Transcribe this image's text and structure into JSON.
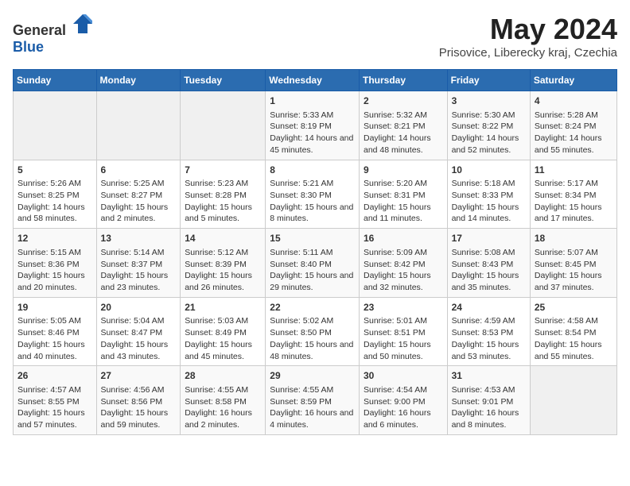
{
  "header": {
    "logo_general": "General",
    "logo_blue": "Blue",
    "title": "May 2024",
    "subtitle": "Prisovice, Liberecky kraj, Czechia"
  },
  "weekdays": [
    "Sunday",
    "Monday",
    "Tuesday",
    "Wednesday",
    "Thursday",
    "Friday",
    "Saturday"
  ],
  "weeks": [
    [
      {
        "day": "",
        "info": ""
      },
      {
        "day": "",
        "info": ""
      },
      {
        "day": "",
        "info": ""
      },
      {
        "day": "1",
        "info": "Sunrise: 5:33 AM\nSunset: 8:19 PM\nDaylight: 14 hours and 45 minutes."
      },
      {
        "day": "2",
        "info": "Sunrise: 5:32 AM\nSunset: 8:21 PM\nDaylight: 14 hours and 48 minutes."
      },
      {
        "day": "3",
        "info": "Sunrise: 5:30 AM\nSunset: 8:22 PM\nDaylight: 14 hours and 52 minutes."
      },
      {
        "day": "4",
        "info": "Sunrise: 5:28 AM\nSunset: 8:24 PM\nDaylight: 14 hours and 55 minutes."
      }
    ],
    [
      {
        "day": "5",
        "info": "Sunrise: 5:26 AM\nSunset: 8:25 PM\nDaylight: 14 hours and 58 minutes."
      },
      {
        "day": "6",
        "info": "Sunrise: 5:25 AM\nSunset: 8:27 PM\nDaylight: 15 hours and 2 minutes."
      },
      {
        "day": "7",
        "info": "Sunrise: 5:23 AM\nSunset: 8:28 PM\nDaylight: 15 hours and 5 minutes."
      },
      {
        "day": "8",
        "info": "Sunrise: 5:21 AM\nSunset: 8:30 PM\nDaylight: 15 hours and 8 minutes."
      },
      {
        "day": "9",
        "info": "Sunrise: 5:20 AM\nSunset: 8:31 PM\nDaylight: 15 hours and 11 minutes."
      },
      {
        "day": "10",
        "info": "Sunrise: 5:18 AM\nSunset: 8:33 PM\nDaylight: 15 hours and 14 minutes."
      },
      {
        "day": "11",
        "info": "Sunrise: 5:17 AM\nSunset: 8:34 PM\nDaylight: 15 hours and 17 minutes."
      }
    ],
    [
      {
        "day": "12",
        "info": "Sunrise: 5:15 AM\nSunset: 8:36 PM\nDaylight: 15 hours and 20 minutes."
      },
      {
        "day": "13",
        "info": "Sunrise: 5:14 AM\nSunset: 8:37 PM\nDaylight: 15 hours and 23 minutes."
      },
      {
        "day": "14",
        "info": "Sunrise: 5:12 AM\nSunset: 8:39 PM\nDaylight: 15 hours and 26 minutes."
      },
      {
        "day": "15",
        "info": "Sunrise: 5:11 AM\nSunset: 8:40 PM\nDaylight: 15 hours and 29 minutes."
      },
      {
        "day": "16",
        "info": "Sunrise: 5:09 AM\nSunset: 8:42 PM\nDaylight: 15 hours and 32 minutes."
      },
      {
        "day": "17",
        "info": "Sunrise: 5:08 AM\nSunset: 8:43 PM\nDaylight: 15 hours and 35 minutes."
      },
      {
        "day": "18",
        "info": "Sunrise: 5:07 AM\nSunset: 8:45 PM\nDaylight: 15 hours and 37 minutes."
      }
    ],
    [
      {
        "day": "19",
        "info": "Sunrise: 5:05 AM\nSunset: 8:46 PM\nDaylight: 15 hours and 40 minutes."
      },
      {
        "day": "20",
        "info": "Sunrise: 5:04 AM\nSunset: 8:47 PM\nDaylight: 15 hours and 43 minutes."
      },
      {
        "day": "21",
        "info": "Sunrise: 5:03 AM\nSunset: 8:49 PM\nDaylight: 15 hours and 45 minutes."
      },
      {
        "day": "22",
        "info": "Sunrise: 5:02 AM\nSunset: 8:50 PM\nDaylight: 15 hours and 48 minutes."
      },
      {
        "day": "23",
        "info": "Sunrise: 5:01 AM\nSunset: 8:51 PM\nDaylight: 15 hours and 50 minutes."
      },
      {
        "day": "24",
        "info": "Sunrise: 4:59 AM\nSunset: 8:53 PM\nDaylight: 15 hours and 53 minutes."
      },
      {
        "day": "25",
        "info": "Sunrise: 4:58 AM\nSunset: 8:54 PM\nDaylight: 15 hours and 55 minutes."
      }
    ],
    [
      {
        "day": "26",
        "info": "Sunrise: 4:57 AM\nSunset: 8:55 PM\nDaylight: 15 hours and 57 minutes."
      },
      {
        "day": "27",
        "info": "Sunrise: 4:56 AM\nSunset: 8:56 PM\nDaylight: 15 hours and 59 minutes."
      },
      {
        "day": "28",
        "info": "Sunrise: 4:55 AM\nSunset: 8:58 PM\nDaylight: 16 hours and 2 minutes."
      },
      {
        "day": "29",
        "info": "Sunrise: 4:55 AM\nSunset: 8:59 PM\nDaylight: 16 hours and 4 minutes."
      },
      {
        "day": "30",
        "info": "Sunrise: 4:54 AM\nSunset: 9:00 PM\nDaylight: 16 hours and 6 minutes."
      },
      {
        "day": "31",
        "info": "Sunrise: 4:53 AM\nSunset: 9:01 PM\nDaylight: 16 hours and 8 minutes."
      },
      {
        "day": "",
        "info": ""
      }
    ]
  ]
}
